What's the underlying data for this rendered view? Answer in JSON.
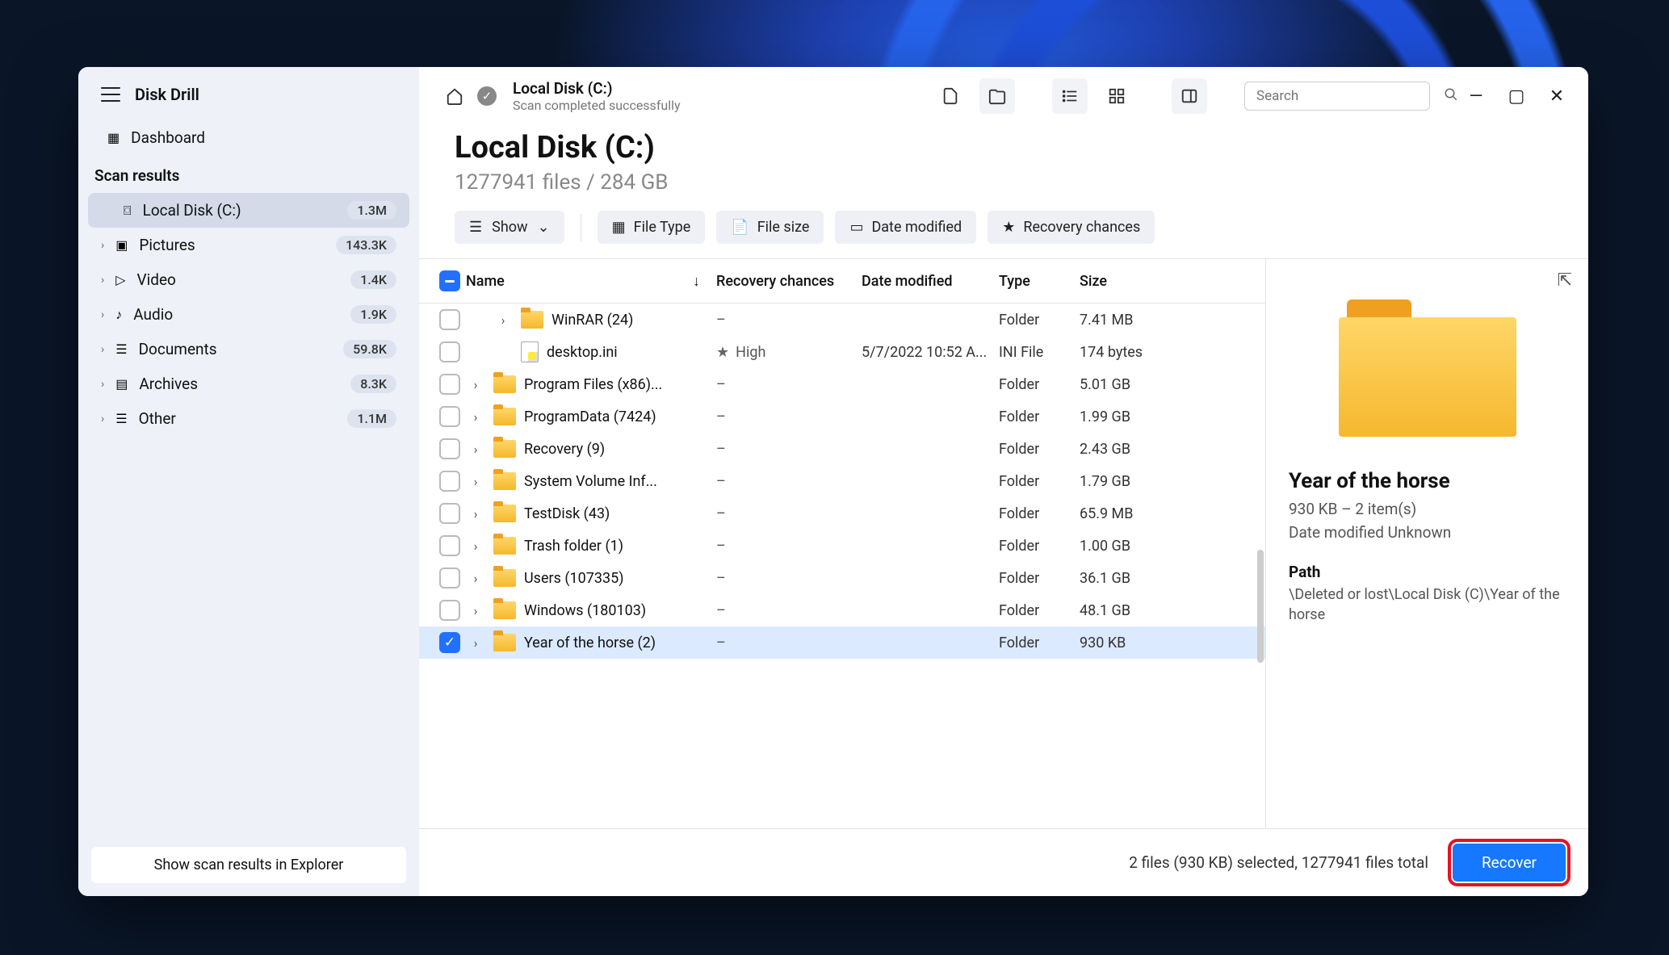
{
  "app": {
    "title": "Disk Drill"
  },
  "sidebar": {
    "dashboard": "Dashboard",
    "scan_results_heading": "Scan results",
    "items": [
      {
        "label": "Local Disk (C:)",
        "badge": "1.3M"
      },
      {
        "label": "Pictures",
        "badge": "143.3K"
      },
      {
        "label": "Video",
        "badge": "1.4K"
      },
      {
        "label": "Audio",
        "badge": "1.9K"
      },
      {
        "label": "Documents",
        "badge": "59.8K"
      },
      {
        "label": "Archives",
        "badge": "8.3K"
      },
      {
        "label": "Other",
        "badge": "1.1M"
      }
    ],
    "explorer_btn": "Show scan results in Explorer"
  },
  "topbar": {
    "breadcrumb_title": "Local Disk (C:)",
    "breadcrumb_sub": "Scan completed successfully",
    "search_placeholder": "Search"
  },
  "header": {
    "title": "Local Disk (C:)",
    "subtitle": "1277941 files / 284 GB"
  },
  "filters": {
    "show": "Show",
    "file_type": "File Type",
    "file_size": "File size",
    "date_modified": "Date modified",
    "recovery_chances": "Recovery chances"
  },
  "columns": {
    "name": "Name",
    "recovery": "Recovery chances",
    "date": "Date modified",
    "type": "Type",
    "size": "Size"
  },
  "rows": [
    {
      "name": "WinRAR (24)",
      "icon": "folder",
      "rec": "–",
      "date": "",
      "type": "Folder",
      "size": "7.41 MB",
      "chk": false,
      "exp": true,
      "indent": 1
    },
    {
      "name": "desktop.ini",
      "icon": "file",
      "rec": "High",
      "rec_icon": true,
      "date": "5/7/2022 10:52 A...",
      "type": "INI File",
      "size": "174 bytes",
      "chk": false,
      "exp": false,
      "indent": 1
    },
    {
      "name": "Program Files (x86)...",
      "icon": "folder",
      "rec": "–",
      "date": "",
      "type": "Folder",
      "size": "5.01 GB",
      "chk": false,
      "exp": true,
      "indent": 0
    },
    {
      "name": "ProgramData (7424)",
      "icon": "folder",
      "rec": "–",
      "date": "",
      "type": "Folder",
      "size": "1.99 GB",
      "chk": false,
      "exp": true,
      "indent": 0
    },
    {
      "name": "Recovery (9)",
      "icon": "folder",
      "rec": "–",
      "date": "",
      "type": "Folder",
      "size": "2.43 GB",
      "chk": false,
      "exp": true,
      "indent": 0
    },
    {
      "name": "System Volume Inf...",
      "icon": "folder",
      "rec": "–",
      "date": "",
      "type": "Folder",
      "size": "1.79 GB",
      "chk": false,
      "exp": true,
      "indent": 0
    },
    {
      "name": "TestDisk (43)",
      "icon": "folder",
      "rec": "–",
      "date": "",
      "type": "Folder",
      "size": "65.9 MB",
      "chk": false,
      "exp": true,
      "indent": 0
    },
    {
      "name": "Trash folder (1)",
      "icon": "folder",
      "rec": "–",
      "date": "",
      "type": "Folder",
      "size": "1.00 GB",
      "chk": false,
      "exp": true,
      "indent": 0
    },
    {
      "name": "Users (107335)",
      "icon": "folder",
      "rec": "–",
      "date": "",
      "type": "Folder",
      "size": "36.1 GB",
      "chk": false,
      "exp": true,
      "indent": 0
    },
    {
      "name": "Windows (180103)",
      "icon": "folder",
      "rec": "–",
      "date": "",
      "type": "Folder",
      "size": "48.1 GB",
      "chk": false,
      "exp": true,
      "indent": 0
    },
    {
      "name": "Year of the horse (2)",
      "icon": "folder",
      "rec": "–",
      "date": "",
      "type": "Folder",
      "size": "930 KB",
      "chk": true,
      "exp": true,
      "indent": 0
    }
  ],
  "details": {
    "title": "Year of the horse",
    "subtitle": "930 KB – 2 item(s)",
    "date_line": "Date modified Unknown",
    "path_label": "Path",
    "path_value": "\\Deleted or lost\\Local Disk (C)\\Year of the horse"
  },
  "footer": {
    "summary": "2 files (930 KB) selected, 1277941 files total",
    "recover": "Recover"
  }
}
